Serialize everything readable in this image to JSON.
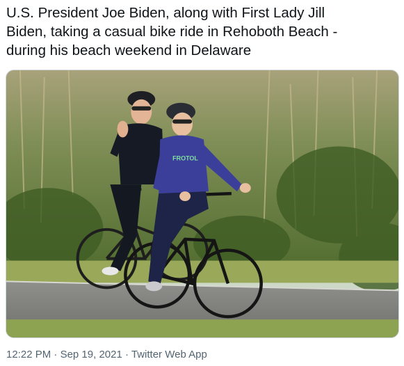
{
  "tweet": {
    "text": "U.S. President Joe Biden, along with First Lady Jill\nBiden, taking a casual bike ride in Rehoboth Beach -\nduring his beach weekend in Delaware",
    "media_text": "FROTOL",
    "timestamp_time": "12:22 PM",
    "separator": " · ",
    "timestamp_date": "Sep 19, 2021",
    "source": "Twitter Web App"
  }
}
